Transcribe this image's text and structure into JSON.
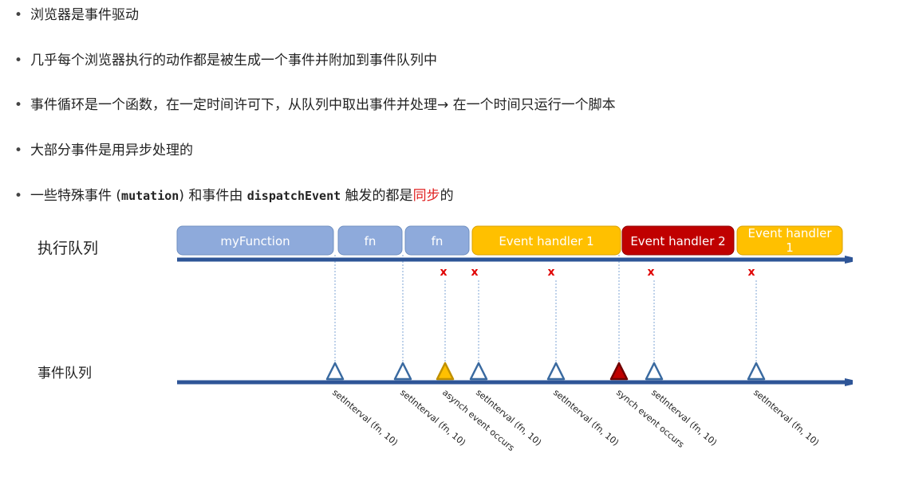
{
  "bullets": [
    {
      "text": "浏览器是事件驱动"
    },
    {
      "text": "几乎每个浏览器执行的动作都是被生成一个事件并附加到事件队列中"
    },
    {
      "text": "事件循环是一个函数，在一定时间许可下，从队列中取出事件并处理→ 在一个时间只运行一个脚本"
    },
    {
      "text": "大部分事件是用异步处理的"
    },
    {
      "text_pre": "一些特殊事件 (",
      "code1": "mutation",
      "text_mid": ") 和事件由 ",
      "code2": "dispatchEvent",
      "text_post": " 触发的都是",
      "highlight": "同步",
      "text_end": "的"
    }
  ],
  "diagram": {
    "exec_label": "执行队列",
    "event_label": "事件队列",
    "blocks": [
      {
        "label": "myFunction",
        "kind": "function"
      },
      {
        "label": "fn",
        "kind": "function"
      },
      {
        "label": "fn",
        "kind": "function"
      },
      {
        "label": "Event handler 1",
        "kind": "async-handler"
      },
      {
        "label": "Event handler 2",
        "kind": "sync-handler"
      },
      {
        "label": "Event handler 1",
        "kind": "async-handler"
      }
    ],
    "x_mark": "x",
    "events": [
      {
        "label": "setInterval (fn, 10)",
        "type": "timer"
      },
      {
        "label": "setInterval (fn, 10)",
        "type": "timer"
      },
      {
        "label": "asynch event occurs",
        "type": "async"
      },
      {
        "label": "setInterval (fn, 10)",
        "type": "timer"
      },
      {
        "label": "setInterval (fn, 10)",
        "type": "timer"
      },
      {
        "label": "synch event occurs",
        "type": "sync"
      },
      {
        "label": "setInterval (fn, 10)",
        "type": "timer"
      },
      {
        "label": "setInterval (fn, 10)",
        "type": "timer"
      }
    ],
    "colors": {
      "function_fill": "#8eaadb",
      "async_fill": "#ffc000",
      "sync_fill": "#c00000",
      "arrow": "#2e5597",
      "x_mark": "#e00000",
      "triangle_stroke": "#3a6aa0"
    }
  }
}
